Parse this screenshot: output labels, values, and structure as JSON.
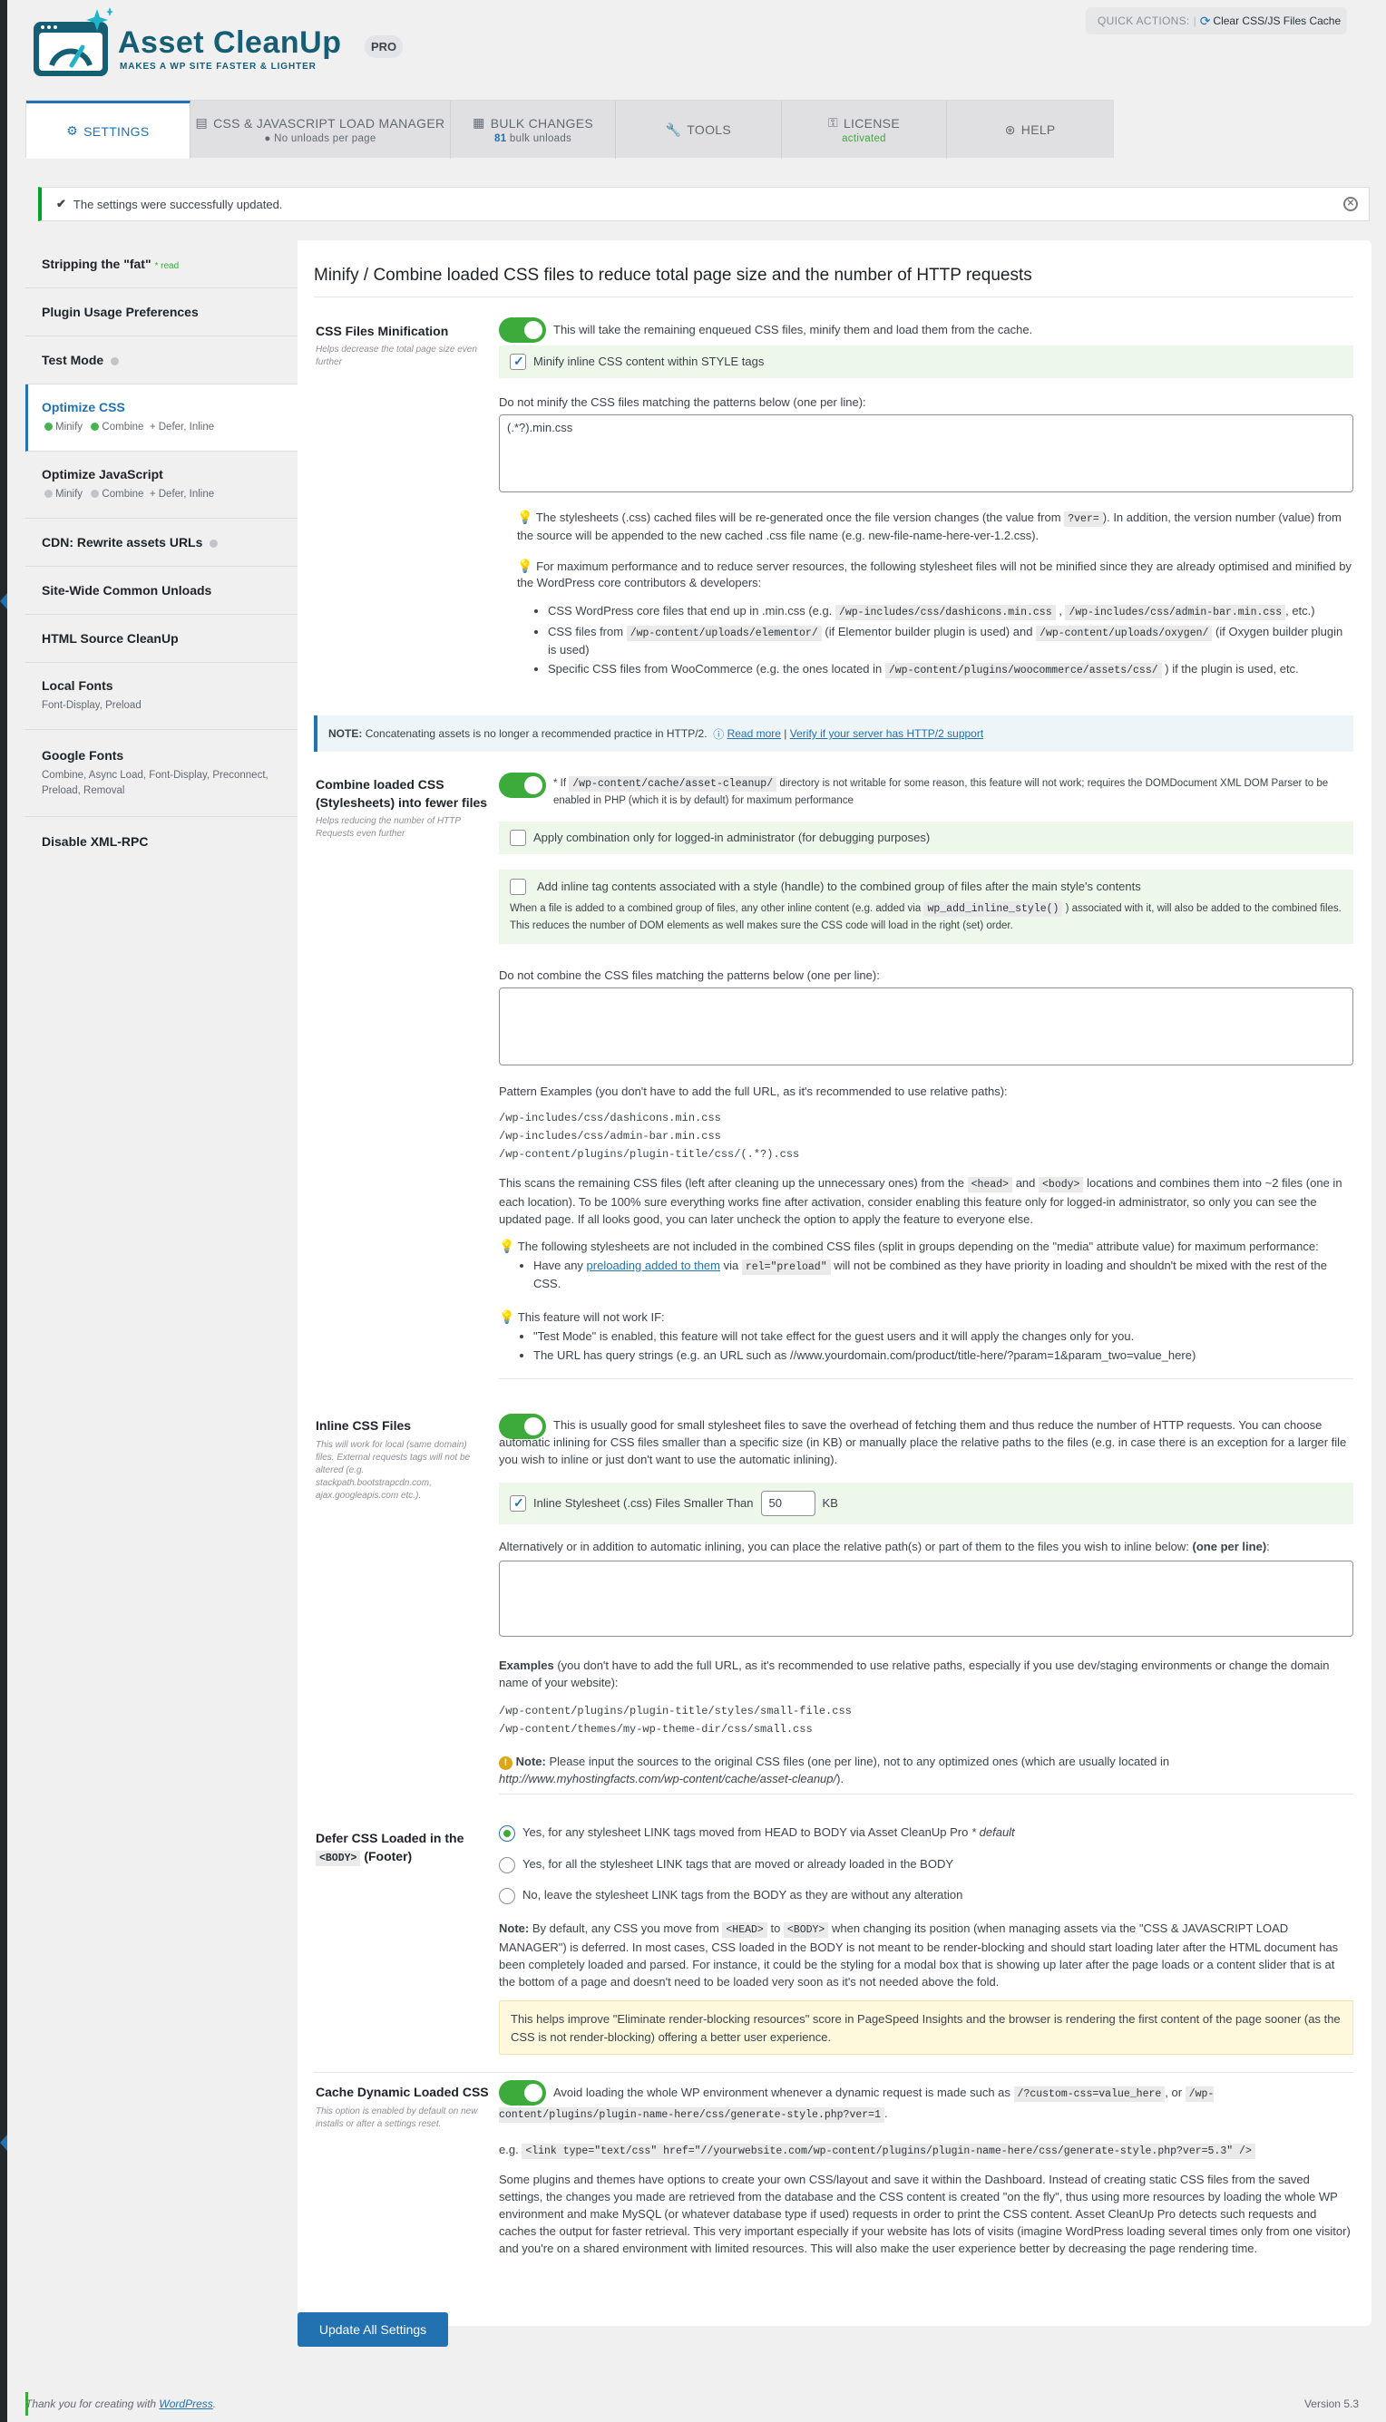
{
  "brand": {
    "name": "Asset CleanUp",
    "tagline": "MAKES A WP SITE FASTER & LIGHTER",
    "badge": "PRO"
  },
  "quick": {
    "label": "QUICK ACTIONS:",
    "button": "Clear CSS/JS Files Cache"
  },
  "tabs": [
    {
      "label": "SETTINGS",
      "sub": "",
      "icon": "gear-icon"
    },
    {
      "label": "CSS & JAVASCRIPT LOAD MANAGER",
      "sub": "No unloads per page",
      "icon": "document-icon"
    },
    {
      "label": "BULK CHANGES",
      "sub_count": "81",
      "sub": "bulk unloads",
      "icon": "cubes-icon"
    },
    {
      "label": "TOOLS",
      "sub": "",
      "icon": "wrench-icon"
    },
    {
      "label": "LICENSE",
      "sub": "activated",
      "icon": "license-icon"
    },
    {
      "label": "HELP",
      "sub": "",
      "icon": "lifebuoy-icon"
    }
  ],
  "notice": "The settings were successfully updated.",
  "sidebar": [
    {
      "label": "Stripping the \"fat\"",
      "extra": "* read"
    },
    {
      "label": "Plugin Usage Preferences"
    },
    {
      "label": "Test Mode"
    },
    {
      "label": "Optimize CSS",
      "s1": "Minify",
      "s2": "Combine",
      "s3": "+ Defer, Inline"
    },
    {
      "label": "Optimize JavaScript",
      "s1": "Minify",
      "s2": "Combine",
      "s3": "+ Defer, Inline"
    },
    {
      "label": "CDN: Rewrite assets URLs"
    },
    {
      "label": "Site-Wide Common Unloads"
    },
    {
      "label": "HTML Source CleanUp"
    },
    {
      "label": "Local Fonts",
      "sub": "Font-Display, Preload"
    },
    {
      "label": "Google Fonts",
      "sub": "Combine, Async Load, Font-Display, Preconnect, Preload, Removal"
    },
    {
      "label": "Disable XML-RPC"
    }
  ],
  "main": {
    "title": "Minify / Combine loaded CSS files to reduce total page size and the number of HTTP requests",
    "minify": {
      "label": "CSS Files Minification",
      "help": "Helps decrease the total page size even further",
      "desc": "This will take the remaining enqueued CSS files, minify them and load them from the cache.",
      "inline_chk": "Minify inline CSS content within STYLE tags",
      "exclude_label": "Do not minify the CSS files matching the patterns below (one per line):",
      "exclude_value": "(.*?).min.css",
      "tip1a": "The stylesheets (.css) cached files will be re-generated once the file version changes (the value from",
      "tip1code": "?ver=",
      "tip1b": "). In addition, the version number (value) from the source will be appended to the new cached .css file name (e.g. new-file-name-here-ver-1.2.css).",
      "tip2": "For maximum performance and to reduce server resources, the following stylesheet files will not be minified since they are already optimised and minified by the WordPress core contributors & developers:",
      "li1a": "CSS WordPress core files that end up in .min.css (e.g.",
      "li1c1": "/wp-includes/css/dashicons.min.css",
      "li1c2": "/wp-includes/css/admin-bar.min.css",
      "li1b": ", etc.)",
      "li2a": "CSS files from",
      "li2c1": "/wp-content/uploads/elementor/",
      "li2b": "(if Elementor builder plugin is used) and",
      "li2c2": "/wp-content/uploads/oxygen/",
      "li2d": "(if Oxygen builder plugin is used)",
      "li3a": "Specific CSS files from WooCommerce (e.g. the ones located in",
      "li3c": "/wp-content/plugins/woocommerce/assets/css/",
      "li3b": ") if the plugin is used, etc."
    },
    "http2": {
      "note": "NOTE:",
      "text": "Concatenating assets is no longer a recommended practice in HTTP/2.",
      "read": "Read more",
      "sep": "|",
      "verify": "Verify if your server has HTTP/2 support"
    },
    "combine": {
      "label": "Combine loaded CSS (Stylesheets) into fewer files",
      "help": "Helps reducing the number of HTTP Requests even further",
      "desc_a": "* If",
      "desc_code": "/wp-content/cache/asset-cleanup/",
      "desc_b": "directory is not writable for some reason, this feature will not work; requires the DOMDocument XML DOM Parser to be enabled in PHP (which it is by default) for maximum performance",
      "chk1": "Apply combination only for logged-in administrator (for debugging purposes)",
      "chk2": "Add inline tag contents associated with a style (handle) to the combined group of files after the main style's contents",
      "chk2_help_a": "When a file is added to a combined group of files, any other inline content (e.g. added via",
      "chk2_help_code": "wp_add_inline_style()",
      "chk2_help_b": ") associated with it, will also be added to the combined files. This reduces the number of DOM elements as well makes sure the CSS code will load in the right (set) order.",
      "exclude_label": "Do not combine the CSS files matching the patterns below (one per line):",
      "pattern_label": "Pattern Examples (you don't have to add the full URL, as it's recommended to use relative paths):",
      "patterns": [
        "/wp-includes/css/dashicons.min.css",
        "/wp-includes/css/admin-bar.min.css",
        "/wp-content/plugins/plugin-title/css/(.*?).css"
      ],
      "scan_a": "This scans the remaining CSS files (left after cleaning up the unnecessary ones) from the",
      "scan_c1": "<head>",
      "scan_and": "and",
      "scan_c2": "<body>",
      "scan_b": "locations and combines them into ~2 files (one in each location). To be 100% sure everything works fine after activation, consider enabling this feature only for logged-in administrator, so only you can see the updated page. If all looks good, you can later uncheck the option to apply the feature to everyone else.",
      "tip1": "The following stylesheets are not included in the combined CSS files (split in groups depending on the \"media\" attribute value) for maximum performance:",
      "tip1_li_a": "Have any",
      "tip1_li_link": "preloading added to them",
      "tip1_li_via": "via",
      "tip1_li_code": "rel=\"preload\"",
      "tip1_li_b": "will not be combined as they have priority in loading and shouldn't be mixed with the rest of the CSS.",
      "tip2": "This feature will not work IF:",
      "tip2_li1": "\"Test Mode\" is enabled, this feature will not take effect for the guest users and it will apply the changes only for you.",
      "tip2_li2": "The URL has query strings (e.g. an URL such as //www.yourdomain.com/product/title-here/?param=1&param_two=value_here)"
    },
    "inline": {
      "label": "Inline CSS Files",
      "help": "This will work for local (same domain) files. External requests tags will not be altered (e.g. stackpath.bootstrapcdn.com, ajax.googleapis.com etc.).",
      "desc": "This is usually good for small stylesheet files to save the overhead of fetching them and thus reduce the number of HTTP requests. You can choose automatic inlining for CSS files smaller than a specific size (in KB) or manually place the relative paths to the files (e.g. in case there is an exception for a larger file you wish to inline or just don't want to use the automatic inlining).",
      "chk": "Inline Stylesheet (.css) Files Smaller Than",
      "kb_value": "50",
      "kb": "KB",
      "alt_a": "Alternatively or in addition to automatic inlining, you can place the relative path(s) or part of them to the files you wish to inline below:",
      "alt_b": "(one per line)",
      "alt_c": ":",
      "ex_a": "Examples",
      "ex_b": "(you don't have to add the full URL, as it's recommended to use relative paths, especially if you use dev/staging environments or change the domain name of your website):",
      "examples": [
        "/wp-content/plugins/plugin-title/styles/small-file.css",
        "/wp-content/themes/my-wp-theme-dir/css/small.css"
      ],
      "note_b": "Note:",
      "note_t": "Please input the sources to the original CSS files (one per line), not to any optimized ones (which are usually located in",
      "note_i": "http://www.myhostingfacts.com/wp-content/cache/asset-cleanup/",
      "note_e": ")."
    },
    "defer": {
      "label_a": "Defer CSS Loaded in the",
      "label_code": "<BODY>",
      "label_b": "(Footer)",
      "r1": "Yes, for any stylesheet LINK tags moved from HEAD to BODY via Asset CleanUp Pro",
      "r1_def": "* default",
      "r2": "Yes, for all the stylesheet LINK tags that are moved or already loaded in the BODY",
      "r3": "No, leave the stylesheet LINK tags from the BODY as they are without any alteration",
      "note_b": "Note:",
      "note_a": "By default, any CSS you move from",
      "note_c1": "<HEAD>",
      "note_to": "to",
      "note_c2": "<BODY>",
      "note_t": "when changing its position (when managing assets via the \"CSS & JAVASCRIPT LOAD MANAGER\") is deferred. In most cases, CSS loaded in the BODY is not meant to be render-blocking and should start loading later after the HTML document has been completely loaded and parsed. For instance, it could be the styling for a modal box that is showing up later after the page loads or a content slider that is at the bottom of a page and doesn't need to be loaded very soon as it's not needed above the fold.",
      "yellow": "This helps improve \"Eliminate render-blocking resources\" score in PageSpeed Insights and the browser is rendering the first content of the page sooner (as the CSS is not render-blocking) offering a better user experience."
    },
    "cache": {
      "label": "Cache Dynamic Loaded CSS",
      "help": "This option is enabled by default on new installs or after a settings reset.",
      "desc_a": "Avoid loading the whole WP environment whenever a dynamic request is made such as",
      "desc_c1": "/?custom-css=value_here",
      "desc_or": ", or",
      "desc_c2": "/wp-content/plugins/plugin-name-here/css/generate-style.php?ver=1",
      "desc_end": ".",
      "eg": "e.g.",
      "eg_code": "<link type=\"text/css\" href=\"//yourwebsite.com/wp-content/plugins/plugin-name-here/css/generate-style.php?ver=5.3\" />",
      "para": "Some plugins and themes have options to create your own CSS/layout and save it within the Dashboard. Instead of creating static CSS files from the saved settings, the changes you made are retrieved from the database and the CSS content is created \"on the fly\", thus using more resources by loading the whole WP environment and make MySQL (or whatever database type if used) requests in order to print the CSS content. Asset CleanUp Pro detects such requests and caches the output for faster retrieval. This very important especially if your website has lots of visits (imagine WordPress loading several times only from one visitor) and you're on a shared environment with limited resources. This will also make the user experience better by decreasing the page rendering time."
    }
  },
  "update_button": "Update All Settings",
  "footer": {
    "text": "Thank you for creating with",
    "link": "WordPress",
    "end": ".",
    "version": "Version 5.3"
  },
  "colors": {
    "accent": "#2271b1",
    "toggle": "#3cab3b",
    "success": "#00a32a"
  }
}
